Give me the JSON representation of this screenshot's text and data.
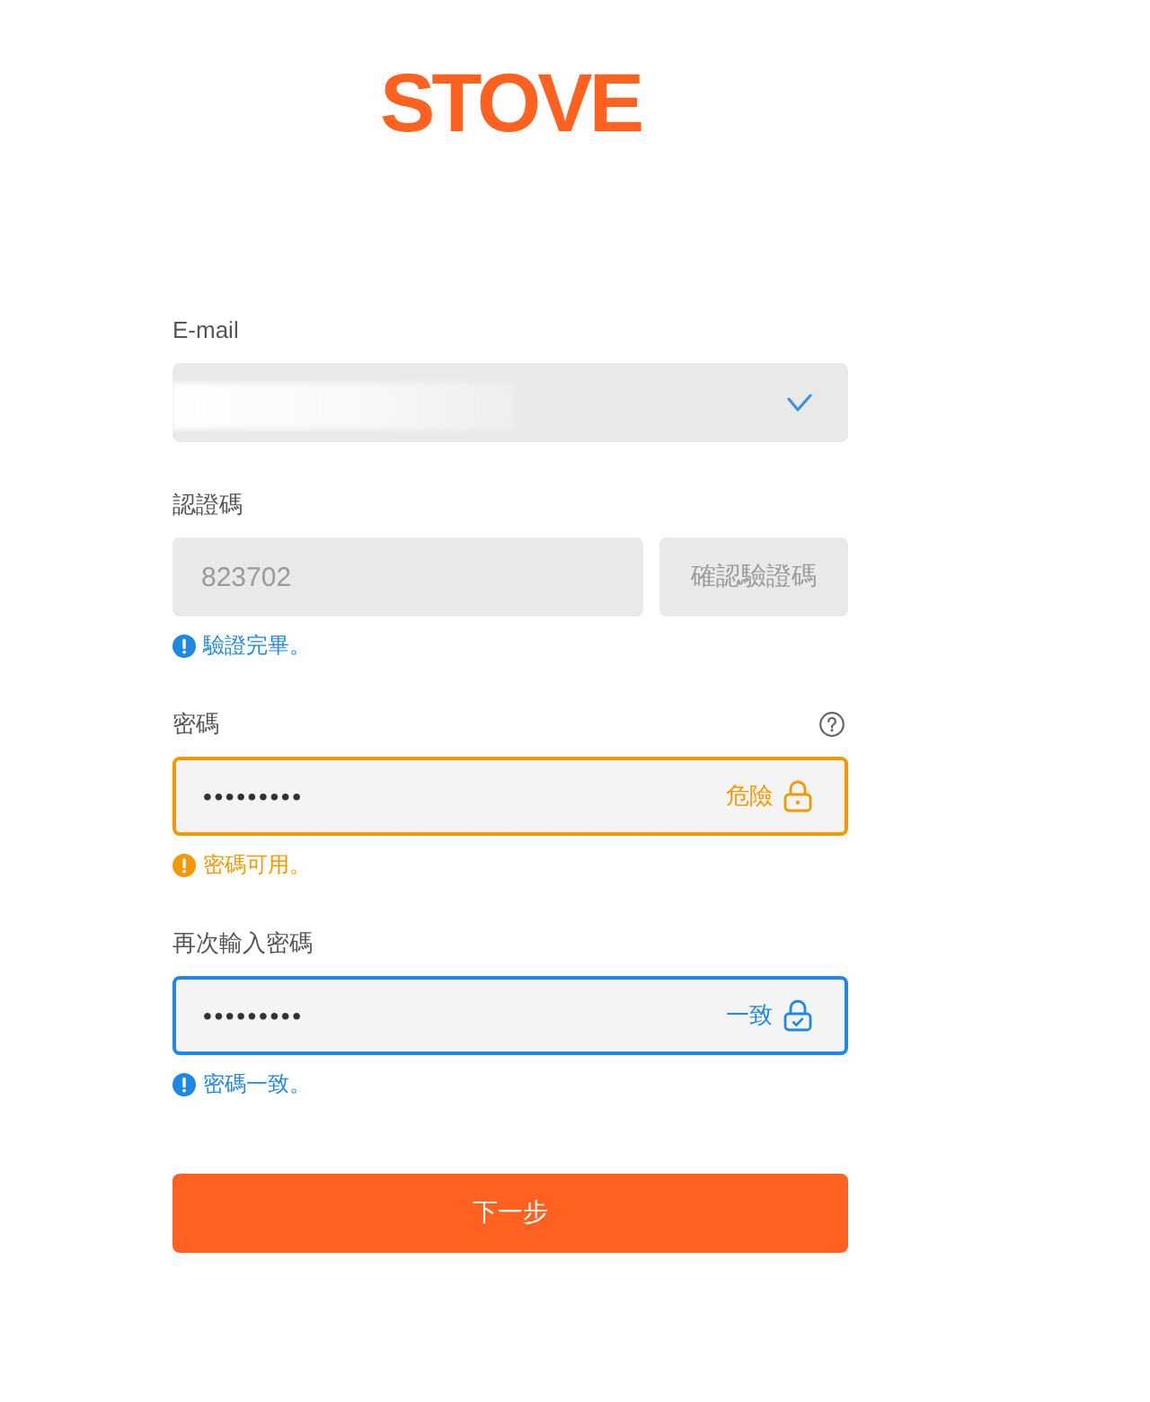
{
  "logo": {
    "text": "STOVE"
  },
  "email": {
    "label": "E-mail",
    "disabled": true,
    "redacted": true,
    "verified": true
  },
  "verification": {
    "label": "認證碼",
    "value": "823702",
    "disabled": true,
    "confirm_button": {
      "label": "確認驗證碼",
      "disabled": true
    },
    "message": {
      "text": "驗證完畢。",
      "warning": false
    }
  },
  "password": {
    "label": "密碼",
    "help": true,
    "value": "•••••••••",
    "warning": true,
    "strength": "危險",
    "message": {
      "text": "密碼可用。",
      "warning": true
    }
  },
  "confirm_password": {
    "label": "再次輸入密碼",
    "value": "•••••••••",
    "warning": false,
    "match": "一致",
    "message": {
      "text": "密碼一致。",
      "warning": false
    }
  },
  "next_button": {
    "label": "下一步"
  }
}
